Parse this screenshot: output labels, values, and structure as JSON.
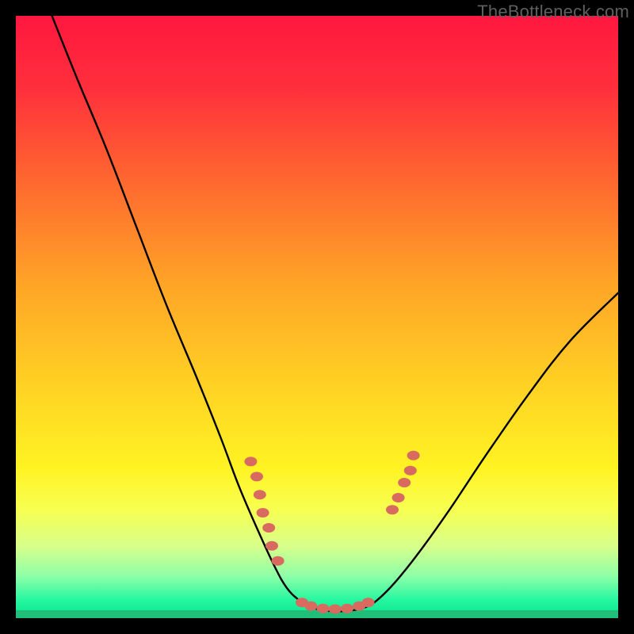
{
  "watermark": "TheBottleneck.com",
  "colors": {
    "gradient_stops": [
      {
        "offset": 0.0,
        "color": "#ff173f"
      },
      {
        "offset": 0.12,
        "color": "#ff2f3c"
      },
      {
        "offset": 0.28,
        "color": "#ff6a2f"
      },
      {
        "offset": 0.45,
        "color": "#ffa626"
      },
      {
        "offset": 0.62,
        "color": "#ffd324"
      },
      {
        "offset": 0.75,
        "color": "#fff323"
      },
      {
        "offset": 0.82,
        "color": "#f7ff51"
      },
      {
        "offset": 0.88,
        "color": "#d8ff8a"
      },
      {
        "offset": 0.93,
        "color": "#8effa8"
      },
      {
        "offset": 0.97,
        "color": "#25f7a0"
      },
      {
        "offset": 1.0,
        "color": "#08e58e"
      }
    ],
    "curve": "#000000",
    "markers": "#d86a60",
    "bottom_band": "#1fbf7a"
  },
  "chart_data": {
    "type": "line",
    "title": "",
    "xlabel": "",
    "ylabel": "",
    "xlim": [
      0,
      100
    ],
    "ylim": [
      0,
      100
    ],
    "grid": false,
    "legend": false,
    "curve_points": [
      {
        "x": 6.0,
        "y": 100.0
      },
      {
        "x": 10.0,
        "y": 90.0
      },
      {
        "x": 15.0,
        "y": 78.0
      },
      {
        "x": 20.0,
        "y": 65.0
      },
      {
        "x": 25.0,
        "y": 52.0
      },
      {
        "x": 30.0,
        "y": 40.0
      },
      {
        "x": 34.0,
        "y": 30.0
      },
      {
        "x": 37.0,
        "y": 22.0
      },
      {
        "x": 40.0,
        "y": 15.0
      },
      {
        "x": 43.0,
        "y": 8.5
      },
      {
        "x": 45.0,
        "y": 5.0
      },
      {
        "x": 47.0,
        "y": 3.0
      },
      {
        "x": 49.0,
        "y": 1.8
      },
      {
        "x": 52.0,
        "y": 1.2
      },
      {
        "x": 55.0,
        "y": 1.2
      },
      {
        "x": 58.0,
        "y": 1.8
      },
      {
        "x": 60.0,
        "y": 3.0
      },
      {
        "x": 63.0,
        "y": 6.0
      },
      {
        "x": 67.0,
        "y": 11.0
      },
      {
        "x": 72.0,
        "y": 18.0
      },
      {
        "x": 78.0,
        "y": 27.0
      },
      {
        "x": 85.0,
        "y": 37.0
      },
      {
        "x": 92.0,
        "y": 46.0
      },
      {
        "x": 100.0,
        "y": 54.0
      }
    ],
    "markers_left": [
      {
        "x": 39.0,
        "y": 26.0
      },
      {
        "x": 40.0,
        "y": 23.5
      },
      {
        "x": 40.5,
        "y": 20.5
      },
      {
        "x": 41.0,
        "y": 17.5
      },
      {
        "x": 42.0,
        "y": 15.0
      },
      {
        "x": 42.5,
        "y": 12.0
      },
      {
        "x": 43.5,
        "y": 9.5
      }
    ],
    "markers_bottom": [
      {
        "x": 47.5,
        "y": 2.6
      },
      {
        "x": 49.0,
        "y": 2.0
      },
      {
        "x": 51.0,
        "y": 1.6
      },
      {
        "x": 53.0,
        "y": 1.5
      },
      {
        "x": 55.0,
        "y": 1.6
      },
      {
        "x": 57.0,
        "y": 2.0
      },
      {
        "x": 58.5,
        "y": 2.6
      }
    ],
    "markers_right": [
      {
        "x": 62.5,
        "y": 18.0
      },
      {
        "x": 63.5,
        "y": 20.0
      },
      {
        "x": 64.5,
        "y": 22.5
      },
      {
        "x": 65.5,
        "y": 24.5
      },
      {
        "x": 66.0,
        "y": 27.0
      }
    ]
  }
}
